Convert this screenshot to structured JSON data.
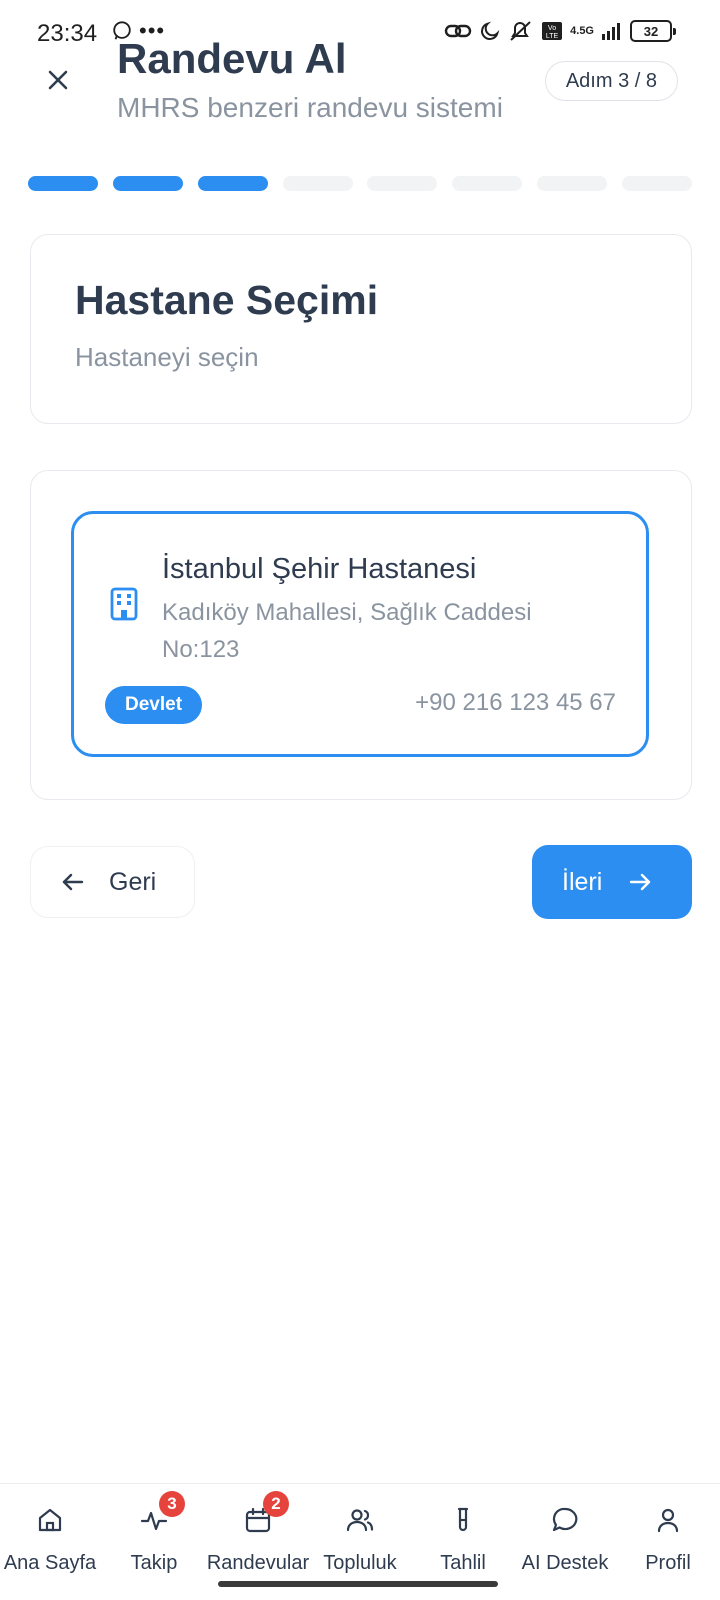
{
  "status_bar": {
    "time": "23:34",
    "network": "4.5G",
    "battery": "32"
  },
  "header": {
    "title": "Randevu Al",
    "subtitle": "MHRS benzeri randevu sistemi",
    "step_indicator": "Adım 3 / 8"
  },
  "progress": {
    "current_step": 3,
    "total_steps": 8
  },
  "step": {
    "title": "Hastane Seçimi",
    "description": "Hastaneyi seçin"
  },
  "hospitals": [
    {
      "name": "İstanbul Şehir Hastanesi",
      "address": "Kadıköy Mahallesi, Sağlık Caddesi No:123",
      "type": "Devlet",
      "phone": "+90 216 123 45 67",
      "selected": true,
      "icon": "building-icon"
    }
  ],
  "navigation": {
    "back_label": "Geri",
    "next_label": "İleri"
  },
  "bottom_nav": {
    "items": [
      {
        "label": "Ana Sayfa",
        "icon": "home-icon"
      },
      {
        "label": "Takip",
        "icon": "activity-icon",
        "badge": "3"
      },
      {
        "label": "Randevular",
        "icon": "calendar-icon",
        "badge": "2"
      },
      {
        "label": "Topluluk",
        "icon": "users-icon"
      },
      {
        "label": "Tahlil",
        "icon": "test-tube-icon"
      },
      {
        "label": "AI Destek",
        "icon": "chat-icon"
      },
      {
        "label": "Profil",
        "icon": "user-icon"
      }
    ]
  },
  "colors": {
    "accent": "#2b8ef0",
    "text": "#2f3c4f",
    "muted": "#8a94a0",
    "badge": "#e5433b"
  }
}
